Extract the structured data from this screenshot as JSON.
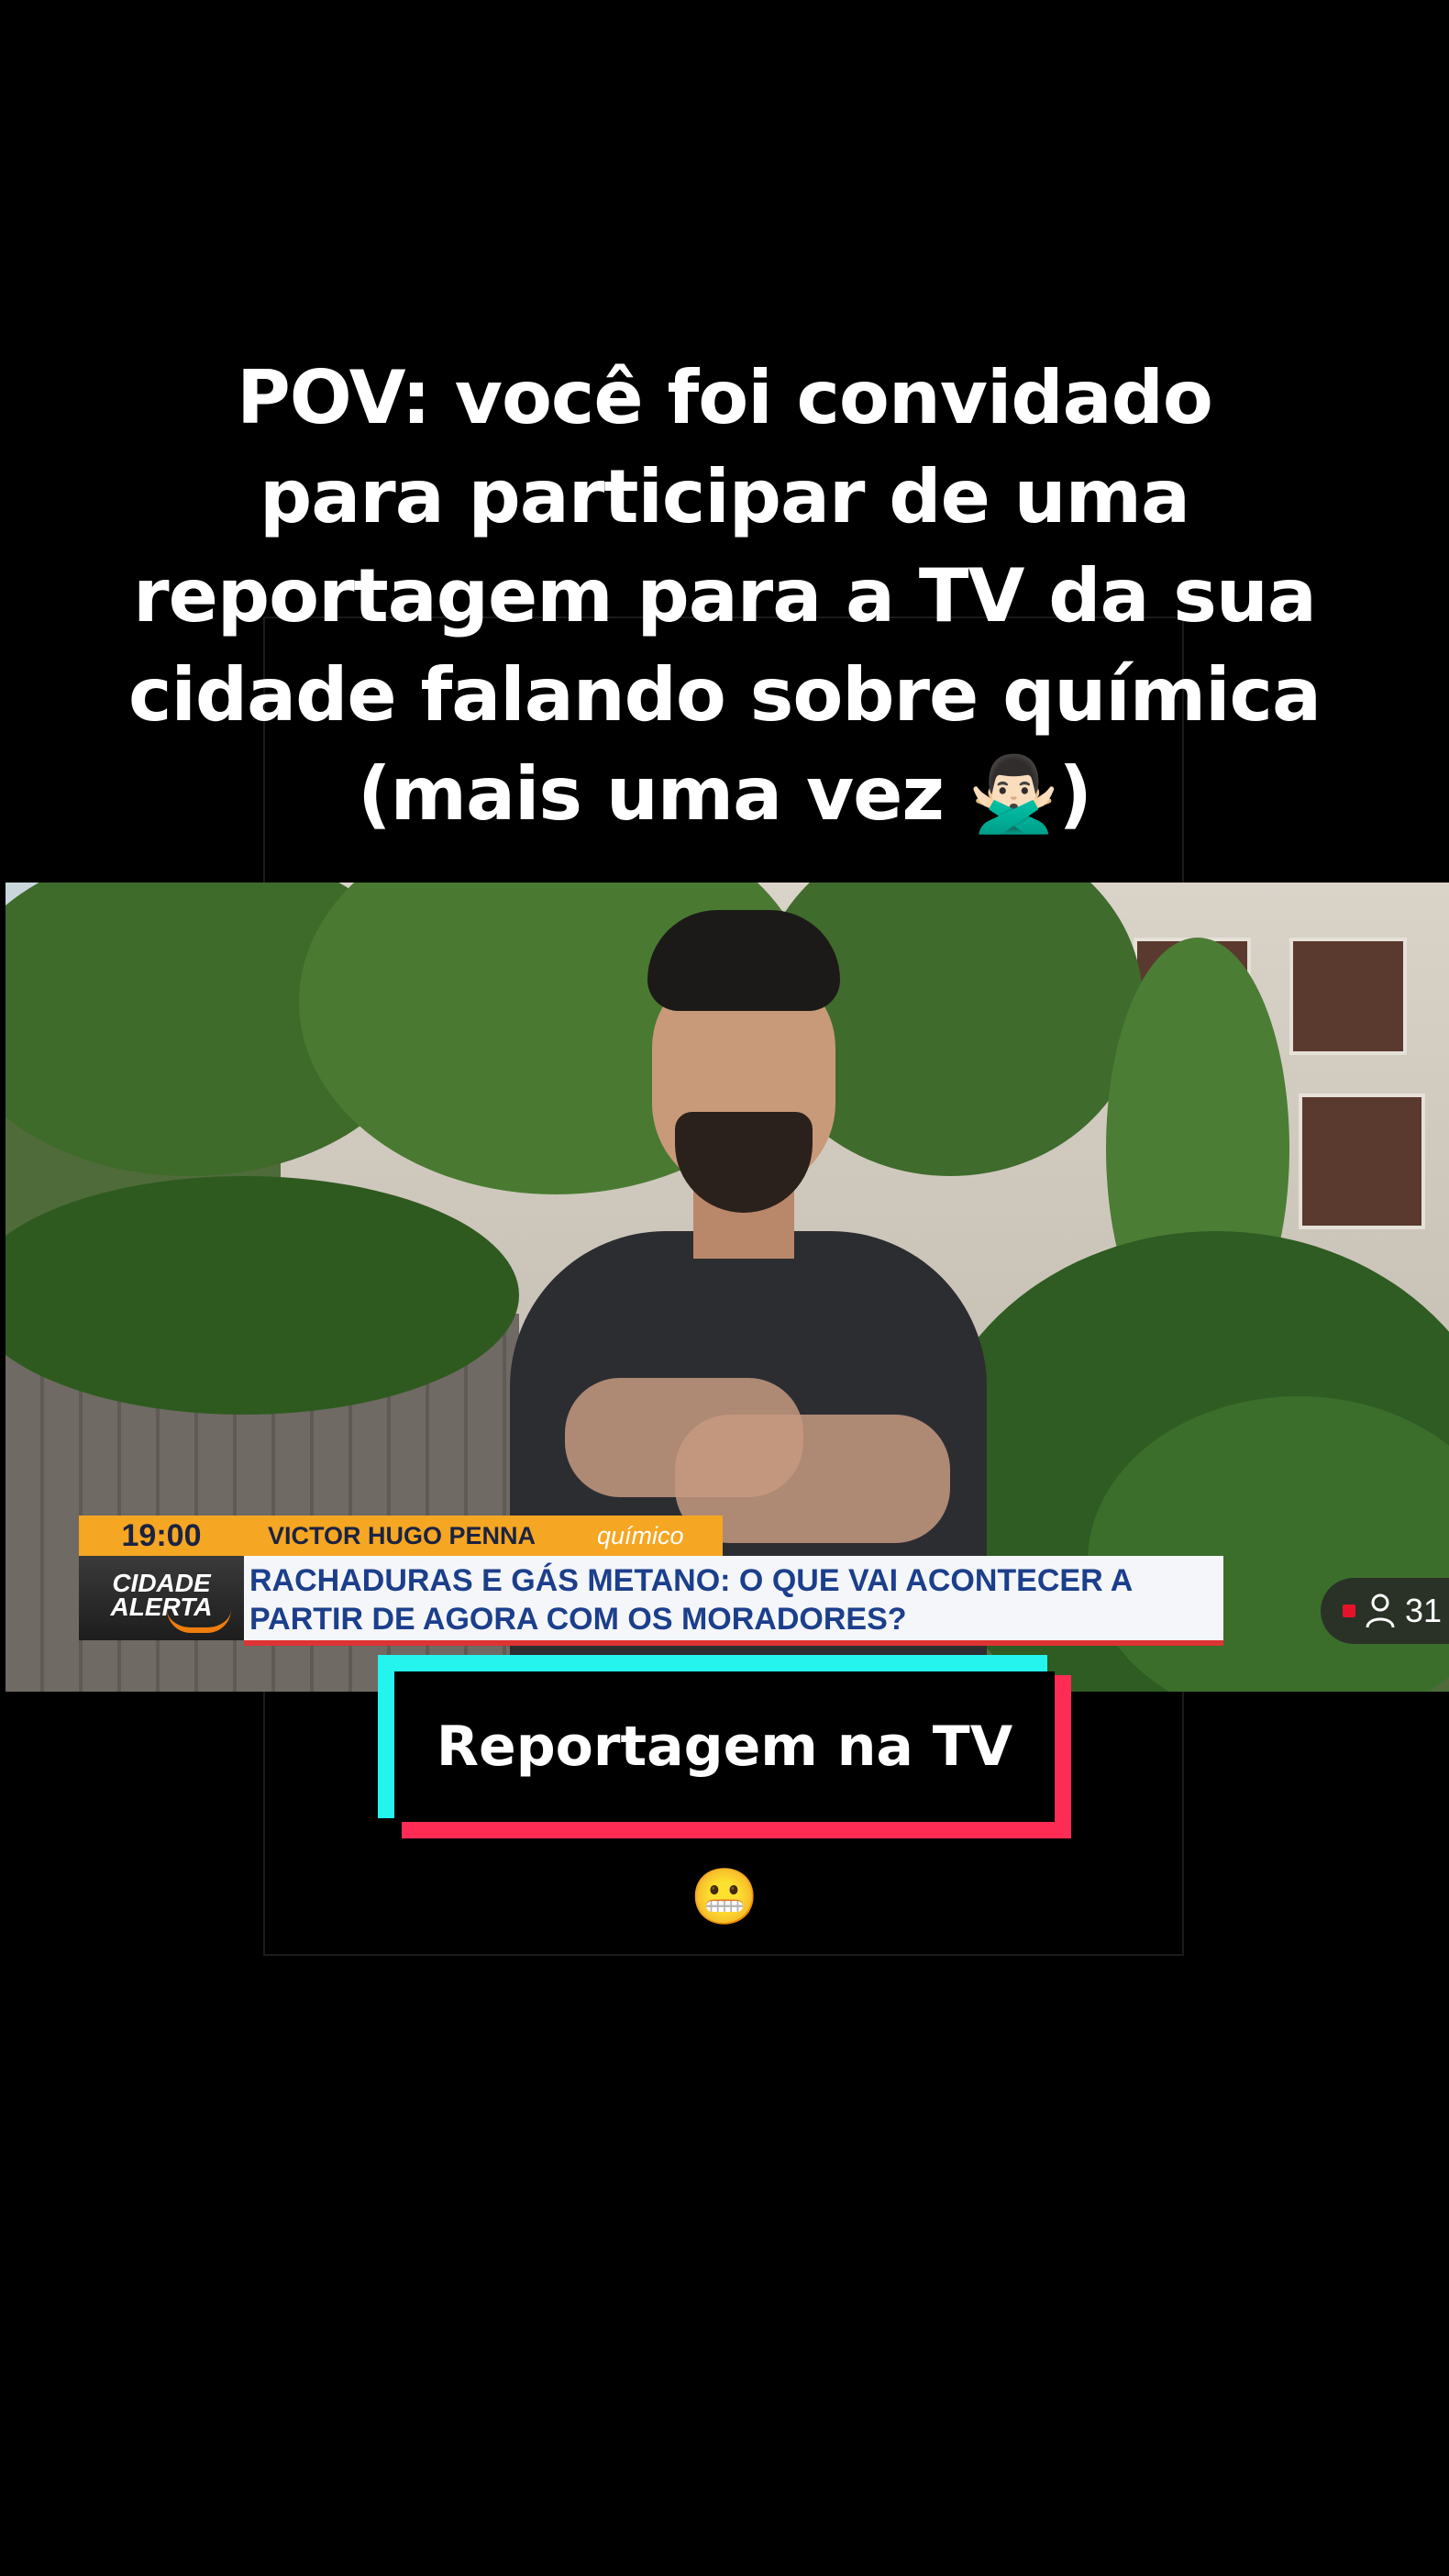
{
  "caption": {
    "lines": [
      "POV: você foi convidado",
      "para participar de uma",
      "reportagem para a TV da sua",
      "cidade falando sobre química",
      "(mais uma vez 🙅🏻‍♂️)"
    ]
  },
  "broadcast": {
    "time": "19:00",
    "name": "VICTOR HUGO PENNA",
    "role": "químico",
    "logo_line1": "CIDADE",
    "logo_line2": "ALERTA",
    "headline_line1": "RACHADURAS E GÁS METANO: O QUE VAI ACONTECER A",
    "headline_line2": "PARTIR DE AGORA COM OS MORADORES?"
  },
  "live_badge": {
    "count": "31"
  },
  "tag": {
    "label": "Reportagem na TV 😬"
  },
  "colors": {
    "lower_third_orange": "#f5a623",
    "headline_blue": "#1c3f8c",
    "tag_cyan": "#25f4ee",
    "tag_red": "#fe2c55"
  }
}
